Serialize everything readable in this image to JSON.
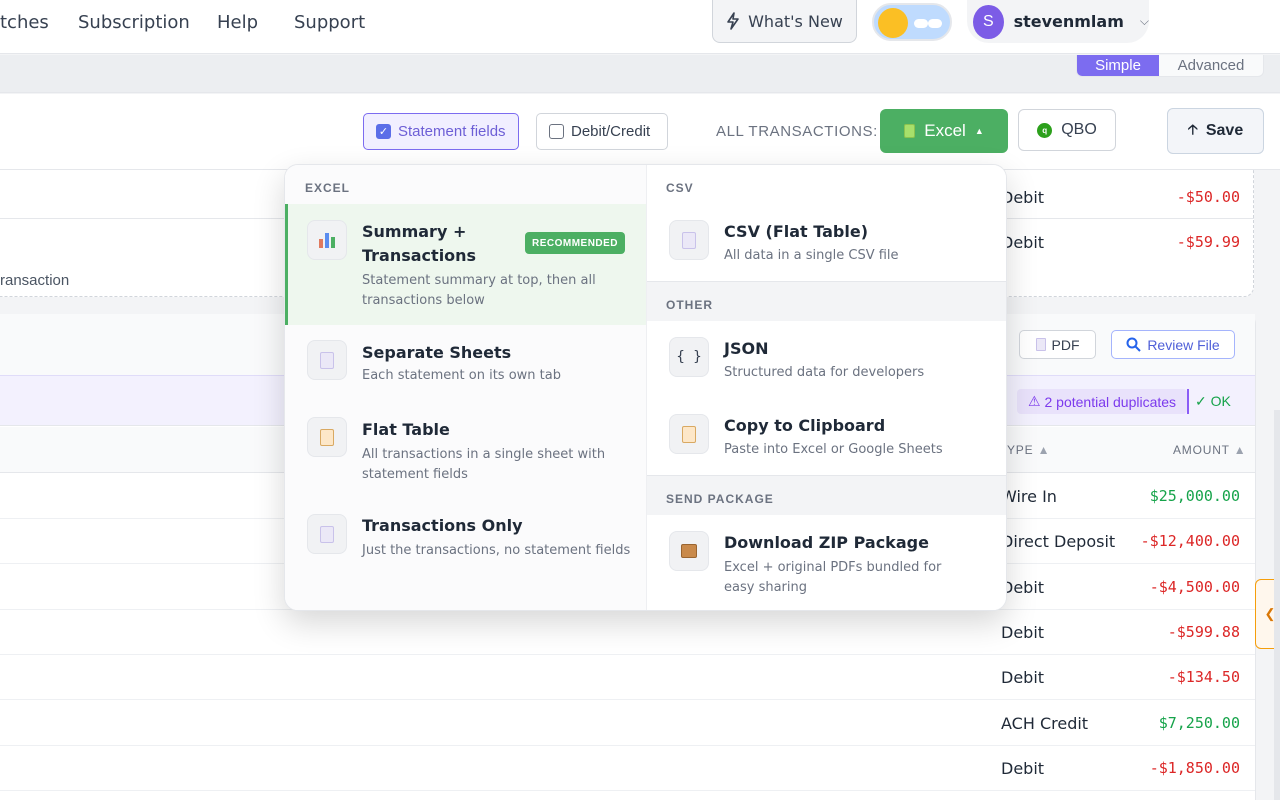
{
  "nav": {
    "links": [
      "tches",
      "Subscription",
      "Help",
      "Support"
    ],
    "whats_new": "What's New",
    "user": {
      "initial": "S",
      "name": "stevenmlam"
    }
  },
  "mode": {
    "simple": "Simple",
    "advanced": "Advanced"
  },
  "toolbar": {
    "statement_fields": "Statement fields",
    "debit_credit": "Debit/Credit",
    "all_transactions": "ALL TRANSACTIONS:",
    "excel": "Excel",
    "qbo": "QBO",
    "save": "Save"
  },
  "upper_rows": [
    {
      "type": "Debit",
      "amount": "-$50.00"
    },
    {
      "type": "Debit",
      "amount": "-$59.99"
    }
  ],
  "upper_fragment": "ransaction",
  "file_actions": {
    "pdf": "PDF",
    "review": "Review File"
  },
  "duplicates": {
    "label": "2 potential duplicates",
    "ok": "✓ OK"
  },
  "columns": {
    "type": "YPE",
    "amount": "AMOUNT"
  },
  "rows": [
    {
      "type": "Wire In",
      "amount": "$25,000.00",
      "sign": "pos"
    },
    {
      "type": "Direct Deposit",
      "amount": "-$12,400.00",
      "sign": "neg"
    },
    {
      "type": "Debit",
      "amount": "-$4,500.00",
      "sign": "neg"
    },
    {
      "type": "Debit",
      "amount": "-$599.88",
      "sign": "neg"
    },
    {
      "type": "Debit",
      "amount": "-$134.50",
      "sign": "neg"
    },
    {
      "type": "ACH Credit",
      "amount": "$7,250.00",
      "sign": "pos"
    },
    {
      "type": "Debit",
      "amount": "-$1,850.00",
      "sign": "neg"
    }
  ],
  "menu": {
    "excel_heading": "EXCEL",
    "excel_items": [
      {
        "title": "Summary + Transactions",
        "desc": "Statement summary at top, then all transactions below",
        "badge": "RECOMMENDED"
      },
      {
        "title": "Separate Sheets",
        "desc": "Each statement on its own tab"
      },
      {
        "title": "Flat Table",
        "desc": "All transactions in a single sheet with statement fields"
      },
      {
        "title": "Transactions Only",
        "desc": "Just the transactions, no statement fields"
      }
    ],
    "csv_heading": "CSV",
    "csv_item": {
      "title": "CSV (Flat Table)",
      "desc": "All data in a single CSV file"
    },
    "other_heading": "OTHER",
    "other_items": [
      {
        "title": "JSON",
        "desc": "Structured data for developers",
        "icon": "{ }"
      },
      {
        "title": "Copy to Clipboard",
        "desc": "Paste into Excel or Google Sheets"
      }
    ],
    "package_heading": "SEND PACKAGE",
    "package_item": {
      "title": "Download ZIP Package",
      "desc": "Excel + original PDFs bundled for easy sharing"
    }
  },
  "colors": {
    "accent": "#7c6cf0",
    "excel_green": "#4caf63",
    "negative": "#dc2626",
    "positive": "#16a34a"
  }
}
